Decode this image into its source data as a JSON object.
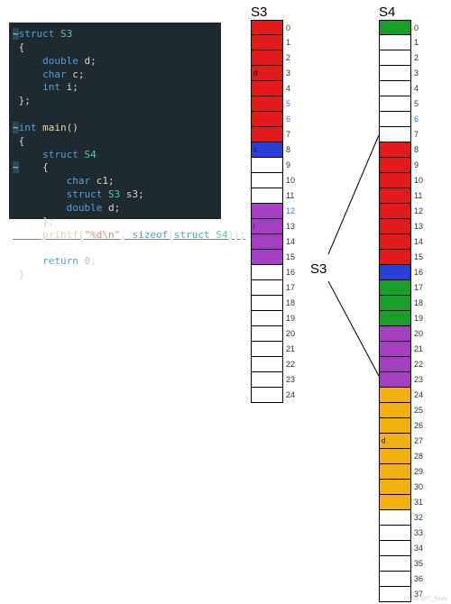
{
  "titles": {
    "s3": "S3",
    "s4": "S4",
    "bridge": "S3"
  },
  "code": {
    "l1": "struct S3",
    "l2": "{",
    "l3": "    double d;",
    "l4": "    char c;",
    "l5": "    int i;",
    "l6": "};",
    "l7": "",
    "l8": "int main()",
    "l9": "{",
    "l10": "    struct S4",
    "l11": "    {",
    "l12": "        char c1;",
    "l13": "        struct S3 s3;",
    "l14": "        double d;",
    "l15": "    };",
    "l16": "    printf(\"%d\\n\", sizeof(struct S4));",
    "l17": "",
    "l18": "    return 0;",
    "l19": "}"
  },
  "colors": {
    "red": "#e21a1a",
    "blue": "#2a3fd6",
    "white": "#ffffff",
    "purple": "#a63fc4",
    "green": "#1a9e2a",
    "gold": "#f2b10f"
  },
  "chart_data": [
    {
      "type": "table",
      "title": "S3",
      "columns": [
        "offset",
        "color",
        "highlight",
        "innerLabel"
      ],
      "rows": [
        [
          0,
          "red",
          false,
          ""
        ],
        [
          1,
          "red",
          false,
          ""
        ],
        [
          2,
          "red",
          false,
          ""
        ],
        [
          3,
          "red",
          false,
          "d"
        ],
        [
          4,
          "red",
          false,
          ""
        ],
        [
          5,
          "red",
          true,
          ""
        ],
        [
          6,
          "red",
          true,
          ""
        ],
        [
          7,
          "red",
          false,
          ""
        ],
        [
          8,
          "blue",
          false,
          "c"
        ],
        [
          9,
          "white",
          false,
          ""
        ],
        [
          10,
          "white",
          false,
          ""
        ],
        [
          11,
          "white",
          false,
          ""
        ],
        [
          12,
          "purple",
          true,
          ""
        ],
        [
          13,
          "purple",
          false,
          "i"
        ],
        [
          14,
          "purple",
          false,
          ""
        ],
        [
          15,
          "purple",
          false,
          ""
        ],
        [
          16,
          "white",
          false,
          ""
        ],
        [
          17,
          "white",
          false,
          ""
        ],
        [
          18,
          "white",
          false,
          ""
        ],
        [
          19,
          "white",
          false,
          ""
        ],
        [
          20,
          "white",
          false,
          ""
        ],
        [
          21,
          "white",
          false,
          ""
        ],
        [
          22,
          "white",
          false,
          ""
        ],
        [
          23,
          "white",
          false,
          ""
        ],
        [
          24,
          "white",
          false,
          ""
        ]
      ]
    },
    {
      "type": "table",
      "title": "S4",
      "columns": [
        "offset",
        "color",
        "highlight",
        "innerLabel"
      ],
      "rows": [
        [
          0,
          "green",
          false,
          ""
        ],
        [
          1,
          "white",
          false,
          ""
        ],
        [
          2,
          "white",
          false,
          ""
        ],
        [
          3,
          "white",
          false,
          ""
        ],
        [
          4,
          "white",
          false,
          ""
        ],
        [
          5,
          "white",
          false,
          ""
        ],
        [
          6,
          "white",
          true,
          ""
        ],
        [
          7,
          "white",
          false,
          ""
        ],
        [
          8,
          "red",
          false,
          ""
        ],
        [
          9,
          "red",
          false,
          ""
        ],
        [
          10,
          "red",
          false,
          ""
        ],
        [
          11,
          "red",
          false,
          ""
        ],
        [
          12,
          "red",
          false,
          ""
        ],
        [
          13,
          "red",
          false,
          ""
        ],
        [
          14,
          "red",
          false,
          ""
        ],
        [
          15,
          "red",
          false,
          ""
        ],
        [
          16,
          "blue",
          false,
          ""
        ],
        [
          17,
          "green",
          false,
          ""
        ],
        [
          18,
          "green",
          false,
          ""
        ],
        [
          19,
          "green",
          false,
          ""
        ],
        [
          20,
          "purple",
          false,
          ""
        ],
        [
          21,
          "purple",
          false,
          ""
        ],
        [
          22,
          "purple",
          false,
          ""
        ],
        [
          23,
          "purple",
          false,
          ""
        ],
        [
          24,
          "gold",
          false,
          ""
        ],
        [
          25,
          "gold",
          false,
          ""
        ],
        [
          26,
          "gold",
          false,
          ""
        ],
        [
          27,
          "gold",
          false,
          "d"
        ],
        [
          28,
          "gold",
          false,
          ""
        ],
        [
          29,
          "gold",
          false,
          ""
        ],
        [
          30,
          "gold",
          false,
          ""
        ],
        [
          31,
          "gold",
          false,
          ""
        ],
        [
          32,
          "white",
          false,
          ""
        ],
        [
          33,
          "white",
          false,
          ""
        ],
        [
          34,
          "white",
          false,
          ""
        ],
        [
          35,
          "white",
          false,
          ""
        ],
        [
          36,
          "white",
          false,
          ""
        ],
        [
          37,
          "white",
          false,
          ""
        ]
      ]
    }
  ],
  "watermark": "CSDN @IT_Stuck"
}
